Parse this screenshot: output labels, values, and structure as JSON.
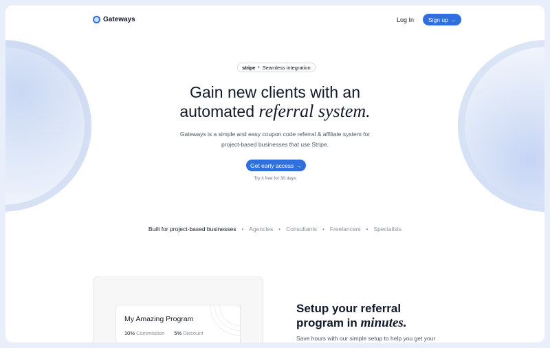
{
  "header": {
    "logo_text": "Gateways",
    "login_label": "Log In",
    "signup_label": "Sign up",
    "signup_arrow": "→"
  },
  "hero": {
    "badge_brand": "stripe",
    "badge_dot": "•",
    "badge_text": "Seamless integration",
    "title_line1": "Gain new clients with an",
    "title_line2_plain": "automated ",
    "title_line2_italic": "referral system.",
    "subtitle": "Gateways is a simple and easy coupon code referral & affiliate system for project-based businesses that use Stripe.",
    "cta_label": "Get early access",
    "cta_arrow": "→",
    "cta_note": "Try it free for 30 days"
  },
  "audience": {
    "lead": "Built for project-based businesses",
    "separator": "•",
    "items": [
      "Agencies",
      "Consultants",
      "Freelancers",
      "Specialists"
    ]
  },
  "program_card": {
    "title": "My Amazing Program",
    "commission_value": "10%",
    "commission_label": "Commission",
    "discount_value": "5%",
    "discount_label": "Discount"
  },
  "setup": {
    "title_line1": "Setup your referral",
    "title_line2_plain": "program in ",
    "title_line2_italic": "minutes.",
    "text": "Save hours with our simple setup to help you get your"
  },
  "colors": {
    "accent": "#2f6fde",
    "page_background": "#e9effa"
  }
}
